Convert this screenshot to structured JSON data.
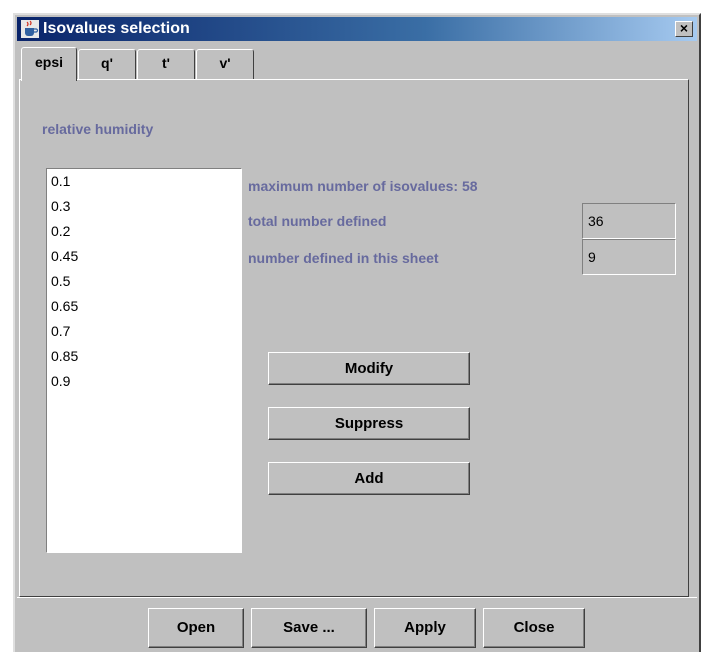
{
  "window": {
    "title": "Isovalues selection",
    "close_label": "×",
    "app_icon": "java-coffee-cup-icon"
  },
  "tabs": [
    {
      "label": "epsi",
      "active": true
    },
    {
      "label": "q'",
      "active": false
    },
    {
      "label": "t'",
      "active": false
    },
    {
      "label": "v'",
      "active": false
    }
  ],
  "panel": {
    "variable_label": "relative humidity",
    "isovalues": [
      "0.1",
      "0.3",
      "0.2",
      "0.45",
      "0.5",
      "0.65",
      "0.7",
      "0.85",
      "0.9"
    ],
    "max_label": "maximum number of isovalues: 58",
    "total_label": "total number defined",
    "total_value": "36",
    "sheet_label": "number defined in this sheet",
    "sheet_value": "9",
    "modify_label": "Modify",
    "suppress_label": "Suppress",
    "add_label": "Add"
  },
  "footer": {
    "open_label": "Open",
    "save_label": "Save ...",
    "apply_label": "Apply",
    "close_label": "Close"
  },
  "colors": {
    "label_text": "#676a9e",
    "background": "#c0c0c0",
    "titlebar_start": "#0a246a"
  }
}
